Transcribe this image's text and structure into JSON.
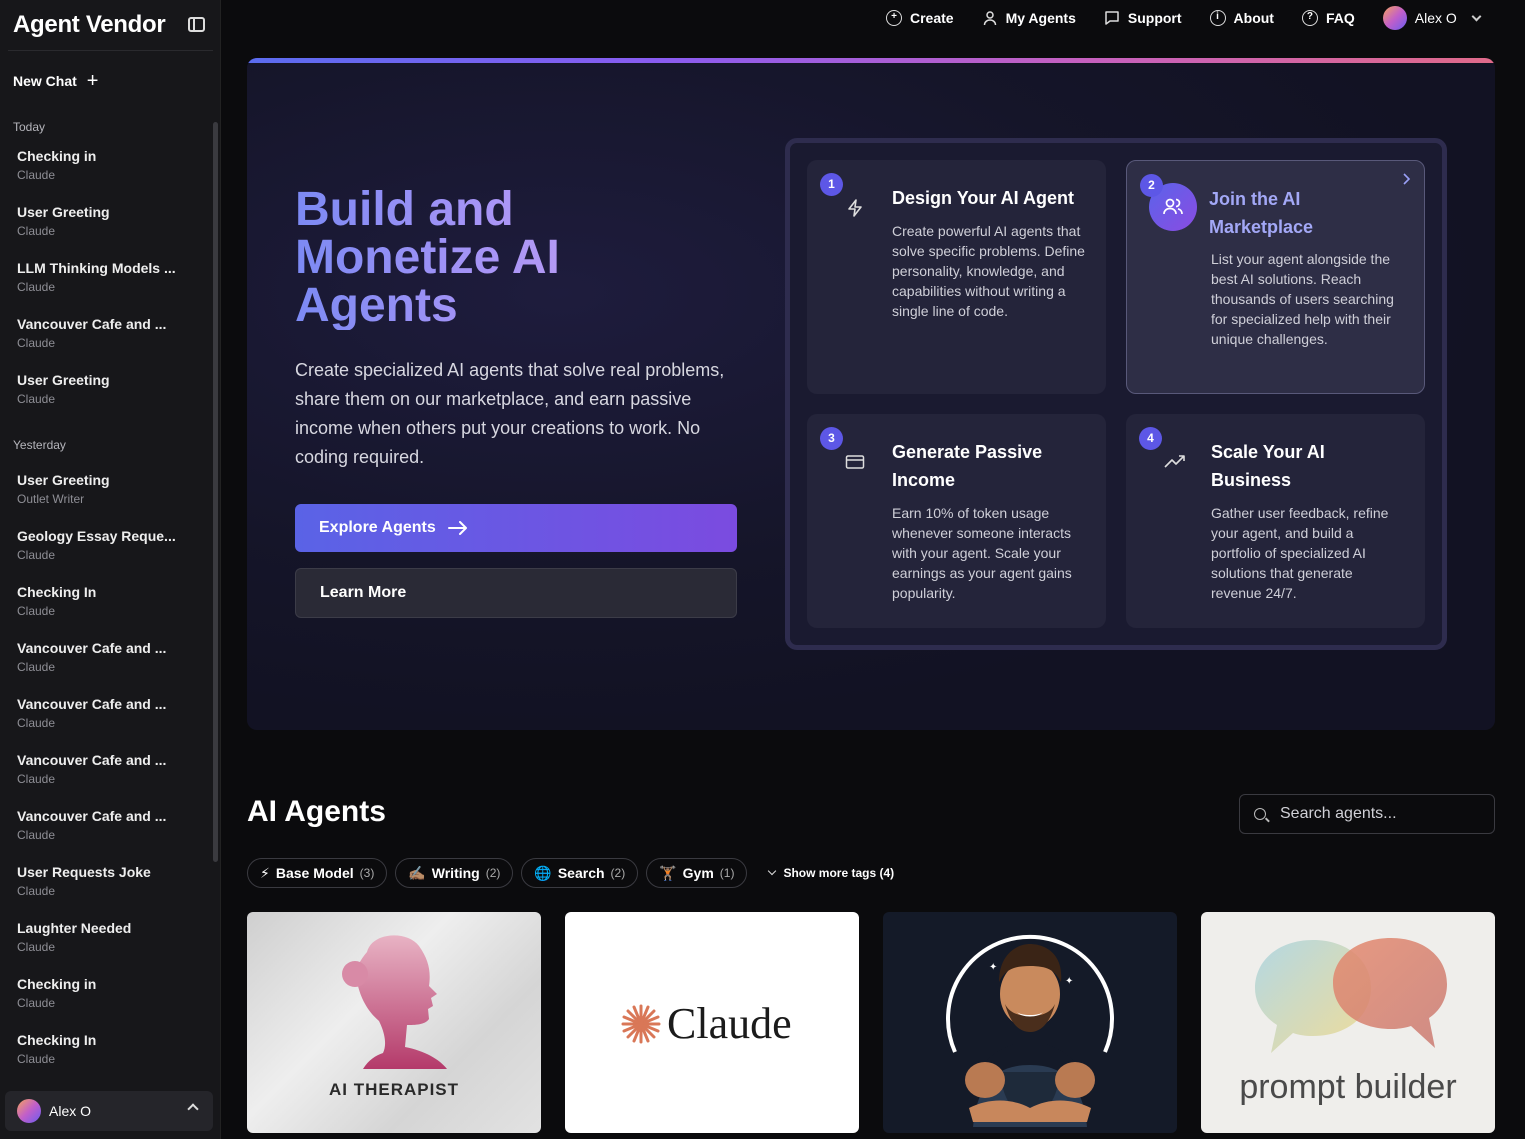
{
  "sidebar": {
    "brand": "Agent Vendor",
    "new_chat": "New Chat",
    "groups": [
      {
        "label": "Today",
        "items": [
          {
            "title": "Checking in",
            "sub": "Claude"
          },
          {
            "title": "User Greeting",
            "sub": "Claude"
          },
          {
            "title": "LLM Thinking Models ...",
            "sub": "Claude"
          },
          {
            "title": "Vancouver Cafe and ...",
            "sub": "Claude"
          },
          {
            "title": "User Greeting",
            "sub": "Claude"
          }
        ]
      },
      {
        "label": "Yesterday",
        "items": [
          {
            "title": "User Greeting",
            "sub": "Outlet Writer"
          },
          {
            "title": "Geology Essay Reque...",
            "sub": "Claude"
          },
          {
            "title": "Checking In",
            "sub": "Claude"
          },
          {
            "title": "Vancouver Cafe and ...",
            "sub": "Claude"
          },
          {
            "title": "Vancouver Cafe and ...",
            "sub": "Claude"
          },
          {
            "title": "Vancouver Cafe and ...",
            "sub": "Claude"
          },
          {
            "title": "Vancouver Cafe and ...",
            "sub": "Claude"
          },
          {
            "title": "User Requests Joke",
            "sub": "Claude"
          },
          {
            "title": "Laughter Needed",
            "sub": "Claude"
          },
          {
            "title": "Checking in",
            "sub": "Claude"
          },
          {
            "title": "Checking In",
            "sub": "Claude"
          }
        ]
      }
    ],
    "user": "Alex O"
  },
  "topnav": {
    "create": "Create",
    "my_agents": "My Agents",
    "support": "Support",
    "about": "About",
    "faq": "FAQ",
    "user": "Alex O"
  },
  "hero": {
    "title": "Build and Monetize AI Agents",
    "description": "Create specialized AI agents that solve real problems, share them on our marketplace, and earn passive income when others put your creations to work. No coding required.",
    "explore": "Explore Agents",
    "learn_more": "Learn More",
    "steps": [
      {
        "num": "1",
        "title": "Design Your AI Agent",
        "text": "Create powerful AI agents that solve specific problems. Define personality, knowledge, and capabilities without writing a single line of code.",
        "icon": "lightning-icon"
      },
      {
        "num": "2",
        "title": "Join the AI Marketplace",
        "text": "List your agent alongside the best AI solutions. Reach thousands of users searching for specialized help with their unique challenges.",
        "icon": "users-icon"
      },
      {
        "num": "3",
        "title": "Generate Passive Income",
        "text": "Earn 10% of token usage whenever someone interacts with your agent. Scale your earnings as your agent gains popularity.",
        "icon": "credit-card-icon"
      },
      {
        "num": "4",
        "title": "Scale Your AI Business",
        "text": "Gather user feedback, refine your agent, and build a portfolio of specialized AI solutions that generate revenue 24/7.",
        "icon": "trending-up-icon"
      }
    ]
  },
  "agents": {
    "title": "AI Agents",
    "search_placeholder": "Search agents...",
    "tags": [
      {
        "emoji": "⚡",
        "label": "Base Model",
        "count": "(3)"
      },
      {
        "emoji": "✍🏽",
        "label": "Writing",
        "count": "(2)"
      },
      {
        "emoji": "🌐",
        "label": "Search",
        "count": "(2)"
      },
      {
        "emoji": "🏋🏽",
        "label": "Gym",
        "count": "(1)"
      }
    ],
    "show_more": "Show more tags (4)",
    "cards": [
      {
        "label": "AI THERAPIST"
      },
      {
        "label": "Claude"
      },
      {
        "label": ""
      },
      {
        "label": "prompt builder"
      }
    ]
  }
}
